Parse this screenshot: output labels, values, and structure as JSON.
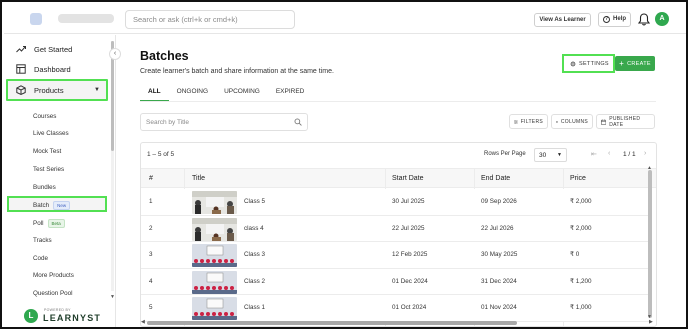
{
  "topbar": {
    "search_placeholder": "Search or ask (ctrl+k or cmd+k)",
    "view_as_learner": "View As Learner",
    "help": "Help",
    "avatar_initial": "A"
  },
  "sidebar": {
    "get_started": "Get Started",
    "dashboard": "Dashboard",
    "products": "Products",
    "sub_items": [
      {
        "label": "Courses"
      },
      {
        "label": "Live Classes"
      },
      {
        "label": "Mock Test"
      },
      {
        "label": "Test Series"
      },
      {
        "label": "Bundles"
      },
      {
        "label": "Batch",
        "badge": "New"
      },
      {
        "label": "Poll",
        "badge": "Beta"
      },
      {
        "label": "Tracks"
      },
      {
        "label": "Code"
      },
      {
        "label": "More Products"
      },
      {
        "label": "Question Pool"
      }
    ],
    "powered_by": "POWERED BY",
    "brand": "LEARNYST"
  },
  "main": {
    "title": "Batches",
    "subtitle": "Create learner's batch and share information at the same time.",
    "settings_label": "SETTINGS",
    "create_label": "CREATE",
    "tabs": [
      "ALL",
      "ONGOING",
      "UPCOMING",
      "EXPIRED"
    ],
    "search_placeholder": "Search by Title",
    "filters_label": "FILTERS",
    "columns_label": "COLUMNS",
    "published_date_label": "PUBLISHED DATE"
  },
  "table": {
    "count_text": "1 – 5 of 5",
    "rows_per_page_label": "Rows Per Page",
    "rows_per_page_value": "30",
    "page_info": "1 / 1",
    "headers": [
      "#",
      "Title",
      "Start Date",
      "End Date",
      "Price"
    ],
    "rows": [
      {
        "num": "1",
        "title": "Class 5",
        "start": "30 Jul 2025",
        "end": "09 Sep 2026",
        "price": "₹ 2,000"
      },
      {
        "num": "2",
        "title": "class 4",
        "start": "22 Jul 2025",
        "end": "22 Jul 2026",
        "price": "₹ 2,000"
      },
      {
        "num": "3",
        "title": "Class 3",
        "start": "12 Feb 2025",
        "end": "30 May 2025",
        "price": "₹ 0"
      },
      {
        "num": "4",
        "title": "Class 2",
        "start": "01 Dec 2024",
        "end": "31 Dec 2024",
        "price": "₹ 1,200"
      },
      {
        "num": "5",
        "title": "Class 1",
        "start": "01 Oct 2024",
        "end": "01 Nov 2024",
        "price": "₹ 1,000"
      }
    ]
  },
  "colors": {
    "accent_green": "#39a84c",
    "highlight_green": "#52e052"
  }
}
